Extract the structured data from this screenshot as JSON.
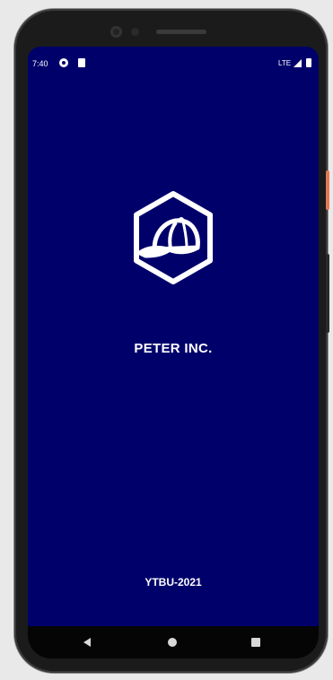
{
  "status_bar": {
    "time": "7:40",
    "network": "LTE",
    "icons": [
      "data-saver-icon",
      "sim-card-icon",
      "signal-icon",
      "battery-icon"
    ]
  },
  "splash": {
    "logo_icon": "baseball-cap-hexagon-icon",
    "company_name": "PETER INC.",
    "footer": "YTBU-2021"
  },
  "navigation": {
    "icons": [
      "back-icon",
      "home-icon",
      "recents-icon"
    ]
  },
  "colors": {
    "background": "#00006b",
    "text": "#ffffff",
    "device_frame": "#1b1b1b",
    "power_button": "#e07a55"
  }
}
